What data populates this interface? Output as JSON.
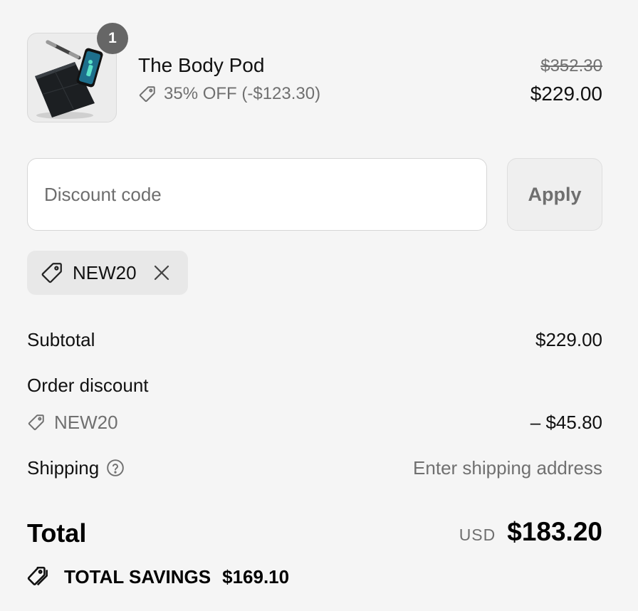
{
  "line_item": {
    "quantity": "1",
    "name": "The Body Pod",
    "discount_text": "35% OFF (-$123.30)",
    "original_price": "$352.30",
    "final_price": "$229.00",
    "image": "smart-scale-with-handle-and-phone"
  },
  "discount_form": {
    "placeholder": "Discount code",
    "value": "",
    "apply_label": "Apply"
  },
  "applied_code": {
    "code": "NEW20",
    "icon": "tag-icon",
    "remove_icon": "close-icon"
  },
  "summary": {
    "subtotal_label": "Subtotal",
    "subtotal_value": "$229.00",
    "order_discount_label": "Order discount",
    "discount_code": "NEW20",
    "discount_value": "– $45.80",
    "shipping_label": "Shipping",
    "shipping_value": "Enter shipping address"
  },
  "total": {
    "label": "Total",
    "currency": "USD",
    "amount": "$183.20"
  },
  "savings": {
    "label": "TOTAL SAVINGS",
    "amount": "$169.10",
    "icon": "tags-icon"
  },
  "colors": {
    "background": "#f5f5f5",
    "muted_text": "#707070",
    "badge": "#666666"
  }
}
